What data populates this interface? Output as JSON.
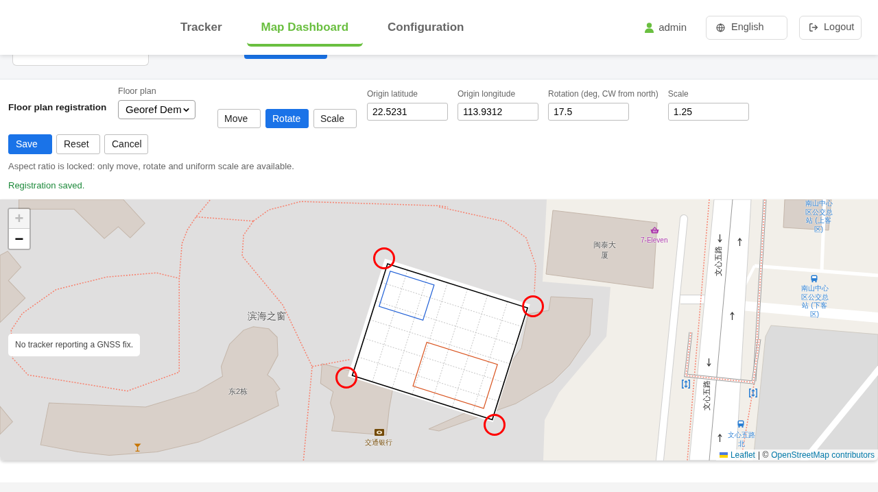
{
  "header": {
    "tabs": [
      {
        "label": "Tracker",
        "selected": false
      },
      {
        "label": "Map Dashboard",
        "selected": true
      },
      {
        "label": "Configuration",
        "selected": false
      }
    ],
    "user": "admin",
    "language_button": "English",
    "logout_button": "Logout"
  },
  "registration": {
    "title": "Floor plan registration",
    "floor_plan": {
      "label": "Floor plan",
      "value": "Georef Dem"
    },
    "modes": [
      {
        "label": "Move",
        "selected": false
      },
      {
        "label": "Rotate",
        "selected": true
      },
      {
        "label": "Scale",
        "selected": false
      }
    ],
    "fields": [
      {
        "label": "Origin latitude",
        "value": "22.5231"
      },
      {
        "label": "Origin longitude",
        "value": "113.9312"
      },
      {
        "label": "Rotation (deg, CW from north)",
        "value": "17.5"
      },
      {
        "label": "Scale",
        "value": "1.25"
      }
    ],
    "actions": [
      {
        "label": "Save",
        "kind": "primary"
      },
      {
        "label": "Reset",
        "kind": "secondary"
      },
      {
        "label": "Cancel",
        "kind": "secondary"
      }
    ],
    "hint": "Aspect ratio is locked: only move, rotate and uniform scale are available.",
    "status": "Registration saved."
  },
  "map": {
    "zoom": [
      {
        "label": "+",
        "disabled": true
      },
      {
        "label": "−",
        "disabled": false
      }
    ],
    "labels": [
      {
        "text": "滨海之窗",
        "kind": "place"
      },
      {
        "text": "东2栋",
        "kind": "building"
      },
      {
        "text": "交通银行",
        "kind": "bank"
      },
      {
        "text": "闽泰大厦",
        "kind": "building"
      },
      {
        "text": "7-Eleven",
        "kind": "poi"
      },
      {
        "text": "文心五路",
        "kind": "road"
      },
      {
        "text": "南山中心区公交总站 (上客区)",
        "kind": "transit"
      },
      {
        "text": "南山中心区公交总站 (下客区)",
        "kind": "transit"
      },
      {
        "text": "文心五路",
        "kind": "road"
      },
      {
        "text": "文心五路北",
        "kind": "transit"
      }
    ],
    "notice": "No tracker reporting a GNSS fix.",
    "attribution": {
      "links": [
        "Leaflet",
        "OpenStreetMap contributors"
      ],
      "separator": "| ©"
    }
  }
}
